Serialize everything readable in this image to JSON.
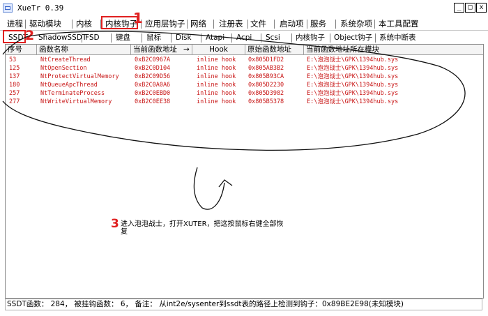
{
  "window": {
    "title": "XueTr 0.39",
    "controls": [
      "_",
      "□",
      "x"
    ]
  },
  "main_tabs": [
    "进程",
    "驱动模块",
    "内核",
    "内核钩子",
    "应用层钩子",
    "网络",
    "注册表",
    "文件",
    "启动项",
    "服务",
    "系统杂项",
    "本工具配置"
  ],
  "sub_tabs": [
    "SSDT",
    "ShadowSSDT",
    "FSD",
    "键盘",
    "鼠标",
    "Disk",
    "Atapi",
    "Acpi",
    "Scsi",
    "内核钩子",
    "Object钩子",
    "系统中断表"
  ],
  "annotations": {
    "num1": "1",
    "num2": "2",
    "num3": "3",
    "note_text": "进入泡泡战士，打开XUTER，把这按鼠标右健全部恢复"
  },
  "table": {
    "columns": [
      "序号",
      "函数名称",
      "当前函数地址",
      "Hook",
      "原始函数地址",
      "当前函数地址所在模块"
    ],
    "sort_indicator": "→",
    "rows": [
      [
        "53",
        "NtCreateThread",
        "0xB2C0967A",
        "inline hook",
        "0x805D1FD2",
        "E:\\泡泡战士\\GPK\\1394hub.sys"
      ],
      [
        "125",
        "NtOpenSection",
        "0xB2C0D104",
        "inline hook",
        "0x805AB3B2",
        "E:\\泡泡战士\\GPK\\1394hub.sys"
      ],
      [
        "137",
        "NtProtectVirtualMemory",
        "0xB2C09D56",
        "inline hook",
        "0x805B93CA",
        "E:\\泡泡战士\\GPK\\1394hub.sys"
      ],
      [
        "180",
        "NtQueueApcThread",
        "0xB2C0A0A6",
        "inline hook",
        "0x805D2230",
        "E:\\泡泡战士\\GPK\\1394hub.sys"
      ],
      [
        "257",
        "NtTerminateProcess",
        "0xB2C0EBD0",
        "inline hook",
        "0x805D3982",
        "E:\\泡泡战士\\GPK\\1394hub.sys"
      ],
      [
        "277",
        "NtWriteVirtualMemory",
        "0xB2C0EE38",
        "inline hook",
        "0x805B5378",
        "E:\\泡泡战士\\GPK\\1394hub.sys"
      ]
    ]
  },
  "status": {
    "text": "SSDT函数： 284， 被挂钩函数： 6， 备注： 从int2e/sysenter到ssdt表的路径上检测到钩子：0x89BE2E98(未知模块)"
  },
  "colors": {
    "row_text": "#c81414",
    "annotation_red": "#e02020"
  }
}
